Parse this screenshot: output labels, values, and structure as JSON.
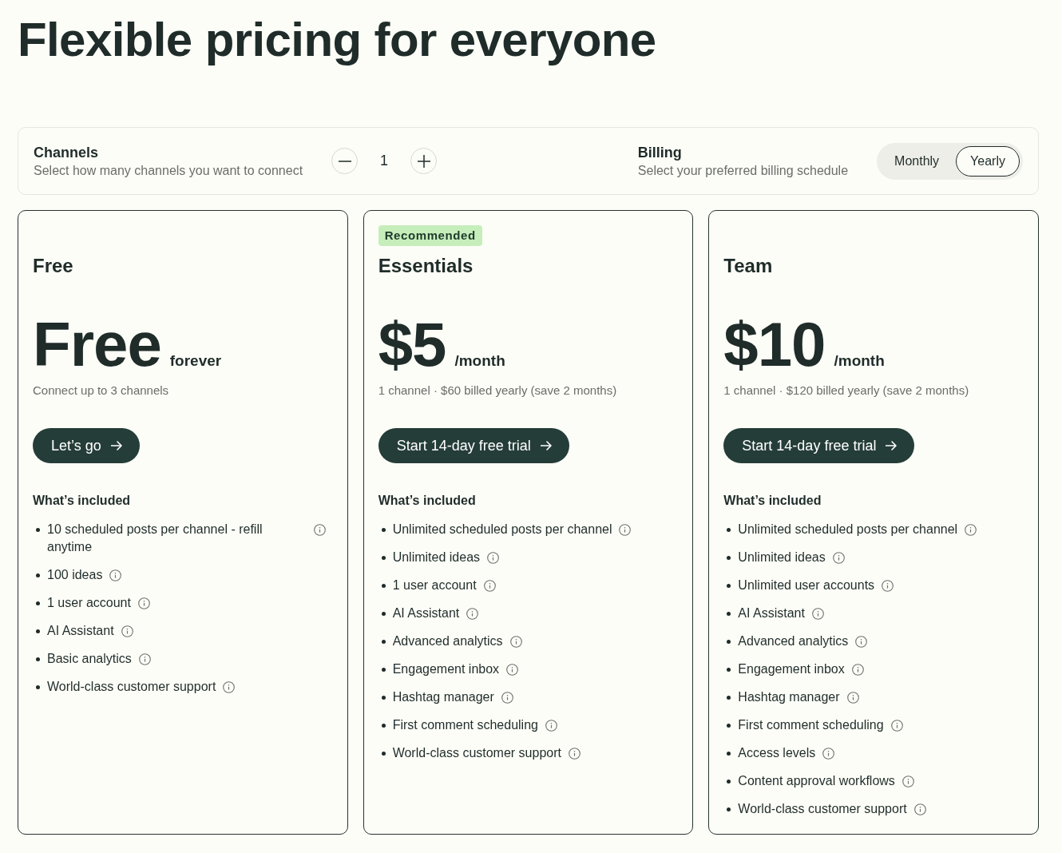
{
  "title": "Flexible pricing for everyone",
  "controls": {
    "channels": {
      "label": "Channels",
      "description": "Select how many channels you want to connect",
      "value": "1"
    },
    "billing": {
      "label": "Billing",
      "description": "Select your preferred billing schedule",
      "options": [
        {
          "label": "Monthly",
          "selected": false
        },
        {
          "label": "Yearly",
          "selected": true
        }
      ]
    }
  },
  "plans": [
    {
      "name": "Free",
      "price": "Free",
      "period": "forever",
      "note": "Connect up to 3 channels",
      "cta": "Let’s go",
      "features_heading": "What’s included",
      "features": [
        "10 scheduled posts per channel - refill anytime",
        "100 ideas",
        "1 user account",
        "AI Assistant",
        "Basic analytics",
        "World-class customer support"
      ]
    },
    {
      "badge": "Recommended",
      "name": "Essentials",
      "price": "$5",
      "period": "/month",
      "note": "1 channel · $60 billed yearly (save 2 months)",
      "cta": "Start 14-day free trial",
      "features_heading": "What’s included",
      "features": [
        "Unlimited scheduled posts per channel",
        "Unlimited ideas",
        "1 user account",
        "AI Assistant",
        "Advanced analytics",
        "Engagement inbox",
        "Hashtag manager",
        "First comment scheduling",
        "World-class customer support"
      ]
    },
    {
      "name": "Team",
      "price": "$10",
      "period": "/month",
      "note": "1 channel · $120 billed yearly (save 2 months)",
      "cta": "Start 14-day free trial",
      "features_heading": "What’s included",
      "features": [
        "Unlimited scheduled posts per channel",
        "Unlimited ideas",
        "Unlimited user accounts",
        "AI Assistant",
        "Advanced analytics",
        "Engagement inbox",
        "Hashtag manager",
        "First comment scheduling",
        "Access levels",
        "Content approval workflows",
        "World-class customer support"
      ]
    }
  ]
}
